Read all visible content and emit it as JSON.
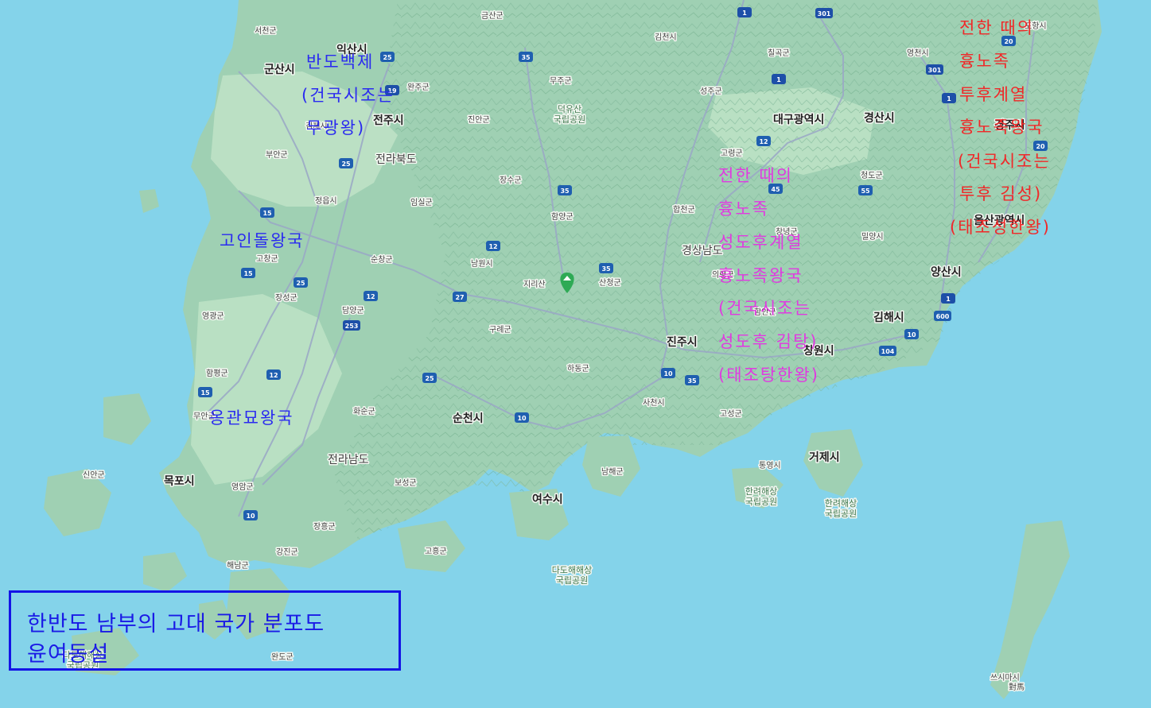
{
  "map": {
    "colors": {
      "sea": "#84d3ea",
      "land": "#9fd0b3",
      "lowland": "#bfe3c7",
      "road": "#9aa7c6",
      "shield_national": "#1d4fa8",
      "shield_expressway": "#1f5fb0",
      "peak_marker": "#2eaa55"
    },
    "city_labels": [
      {
        "name": "군산시",
        "kind": "major"
      },
      {
        "name": "익산시",
        "kind": "major"
      },
      {
        "name": "전주시",
        "kind": "major"
      },
      {
        "name": "전라북도",
        "kind": "prov"
      },
      {
        "name": "대구광역시",
        "kind": "major"
      },
      {
        "name": "경산시",
        "kind": "major"
      },
      {
        "name": "경주시",
        "kind": "major"
      },
      {
        "name": "울산광역시",
        "kind": "major"
      },
      {
        "name": "양산시",
        "kind": "major"
      },
      {
        "name": "김해시",
        "kind": "major"
      },
      {
        "name": "창원시",
        "kind": "major"
      },
      {
        "name": "진주시",
        "kind": "major"
      },
      {
        "name": "순천시",
        "kind": "major"
      },
      {
        "name": "여수시",
        "kind": "major"
      },
      {
        "name": "목포시",
        "kind": "major"
      },
      {
        "name": "전라남도",
        "kind": "prov"
      },
      {
        "name": "경상남도",
        "kind": "prov"
      },
      {
        "name": "거제시",
        "kind": "major"
      },
      {
        "name": "서천군",
        "kind": "small"
      },
      {
        "name": "금산군",
        "kind": "small"
      },
      {
        "name": "완주군",
        "kind": "small"
      },
      {
        "name": "무주군",
        "kind": "small"
      },
      {
        "name": "김천시",
        "kind": "small"
      },
      {
        "name": "칠곡군",
        "kind": "small"
      },
      {
        "name": "영천시",
        "kind": "small"
      },
      {
        "name": "포항시",
        "kind": "small"
      },
      {
        "name": "성주군",
        "kind": "small"
      },
      {
        "name": "진안군",
        "kind": "small"
      },
      {
        "name": "고령군",
        "kind": "small"
      },
      {
        "name": "부안군",
        "kind": "small"
      },
      {
        "name": "장수군",
        "kind": "small"
      },
      {
        "name": "청도군",
        "kind": "small"
      },
      {
        "name": "정읍시",
        "kind": "small"
      },
      {
        "name": "임실군",
        "kind": "small"
      },
      {
        "name": "함양군",
        "kind": "small"
      },
      {
        "name": "합천군",
        "kind": "small"
      },
      {
        "name": "밀양시",
        "kind": "small"
      },
      {
        "name": "고창군",
        "kind": "small"
      },
      {
        "name": "순창군",
        "kind": "small"
      },
      {
        "name": "남원시",
        "kind": "small"
      },
      {
        "name": "산청군",
        "kind": "small"
      },
      {
        "name": "장성군",
        "kind": "small"
      },
      {
        "name": "담양군",
        "kind": "small"
      },
      {
        "name": "영광군",
        "kind": "small"
      },
      {
        "name": "구례군",
        "kind": "small"
      },
      {
        "name": "함평군",
        "kind": "small"
      },
      {
        "name": "하동군",
        "kind": "small"
      },
      {
        "name": "무안군",
        "kind": "small"
      },
      {
        "name": "화순군",
        "kind": "small"
      },
      {
        "name": "사천시",
        "kind": "small"
      },
      {
        "name": "고성군",
        "kind": "small"
      },
      {
        "name": "신안군",
        "kind": "small"
      },
      {
        "name": "보성군",
        "kind": "small"
      },
      {
        "name": "남해군",
        "kind": "small"
      },
      {
        "name": "통영시",
        "kind": "small"
      },
      {
        "name": "영암군",
        "kind": "small"
      },
      {
        "name": "장흥군",
        "kind": "small"
      },
      {
        "name": "강진군",
        "kind": "small"
      },
      {
        "name": "고흥군",
        "kind": "small"
      },
      {
        "name": "해남군",
        "kind": "small"
      },
      {
        "name": "완도군",
        "kind": "small"
      },
      {
        "name": "쓰시마시",
        "kind": "small"
      },
      {
        "name": "의령군",
        "kind": "small"
      },
      {
        "name": "창녕군",
        "kind": "small"
      },
      {
        "name": "함안군",
        "kind": "small"
      },
      {
        "name": "김제시",
        "kind": "small"
      },
      {
        "name": "對馬",
        "kind": "small"
      },
      {
        "name": "지리산",
        "kind": "small"
      }
    ],
    "park_labels": [
      {
        "name": "덕유산\n국립공원"
      },
      {
        "name": "한려해상\n국립공원"
      },
      {
        "name": "한려해상\n국립공원"
      },
      {
        "name": "다도해해상\n국립공원"
      },
      {
        "name": "다도해해상\n국립공원"
      }
    ],
    "road_shields": [
      "1",
      "301",
      "25",
      "35",
      "20",
      "301",
      "1",
      "19",
      "1",
      "12",
      "25",
      "45",
      "55",
      "20",
      "35",
      "15",
      "12",
      "15",
      "25",
      "35",
      "12",
      "27",
      "253",
      "12",
      "1",
      "600",
      "15",
      "25",
      "10",
      "104",
      "10",
      "35",
      "10",
      "10"
    ],
    "peak_marker_icon": "mountain-pin-icon"
  },
  "annotations": {
    "baekje": [
      "반도백제",
      "(건국시조는",
      "무광왕)"
    ],
    "goindol": [
      "고인돌왕국"
    ],
    "onggwan": [
      "옹관묘왕국"
    ],
    "silla": [
      "전한 때의",
      "흉노족",
      "투후계열",
      "흉노족왕국",
      "(건국시조는",
      "투후 김성)",
      "(태조성한왕)"
    ],
    "gaya": [
      "전한 때의",
      "흉노족",
      "성도후계열",
      "흉노족왕국",
      "(건국시조는",
      "성도후 김탕)",
      "(태조탕한왕)"
    ]
  },
  "legend": {
    "title": "한반도 남부의 고대 국가 분포도",
    "author": "윤여동설"
  }
}
